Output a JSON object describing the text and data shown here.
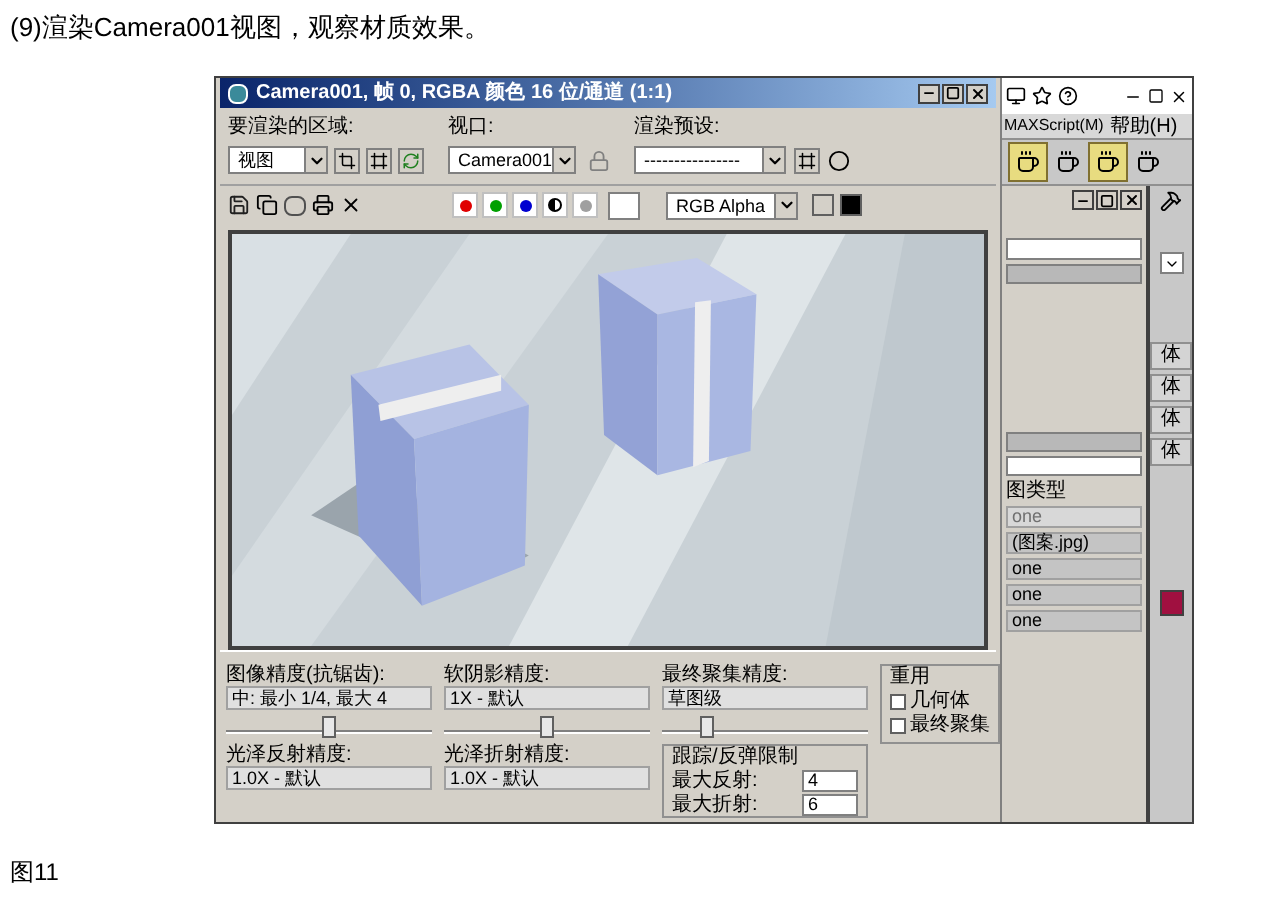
{
  "caption": "(9)渲染Camera001视图，观察材质效果。",
  "render_window": {
    "title": "Camera001, 帧 0, RGBA 颜色 16 位/通道 (1:1)",
    "area": {
      "label": "要渲染的区域:",
      "value": "视图"
    },
    "viewport": {
      "label": "视口:",
      "value": "Camera001"
    },
    "preset": {
      "label": "渲染预设:",
      "value": "----------------"
    },
    "channels": [
      {
        "kind": "color",
        "color": "#e00000"
      },
      {
        "kind": "color",
        "color": "#00a000"
      },
      {
        "kind": "color",
        "color": "#0000d0"
      },
      {
        "kind": "mono"
      },
      {
        "kind": "alpha"
      }
    ],
    "display": "RGB Alpha",
    "precision": [
      {
        "label": "图像精度(抗锯齿):",
        "value": "中: 最小 1/4, 最大 4",
        "level": 0.5
      },
      {
        "label": "软阴影精度:",
        "value": "1X - 默认",
        "level": 0.5
      },
      {
        "label": "最终聚集精度:",
        "value": "草图级",
        "level": 0.22
      }
    ],
    "glossy": [
      {
        "label": "光泽反射精度:",
        "value": "1.0X - 默认"
      },
      {
        "label": "光泽折射精度:",
        "value": "1.0X - 默认"
      }
    ],
    "trace_limits": {
      "title": "跟踪/反弹限制",
      "rows": [
        {
          "label": "最大反射:",
          "value": "4"
        },
        {
          "label": "最大折射:",
          "value": "6"
        }
      ]
    },
    "reuse": {
      "title": "重用",
      "options": [
        {
          "label": "几何体",
          "checked": false
        },
        {
          "label": "最终聚集",
          "checked": false
        }
      ]
    }
  },
  "max_ui": {
    "menu": [
      "MAXScript(M)",
      "帮助(H)"
    ],
    "side_labels": [
      "体",
      "体",
      "体",
      "体"
    ],
    "map_type": "图类型",
    "maps": [
      {
        "label": "one",
        "disabled": true
      },
      {
        "label": "(图案.jpg)",
        "disabled": false
      },
      {
        "label": "one",
        "disabled": false
      },
      {
        "label": "one",
        "disabled": false
      },
      {
        "label": "one",
        "disabled": false
      }
    ]
  },
  "figure_label": "图11"
}
